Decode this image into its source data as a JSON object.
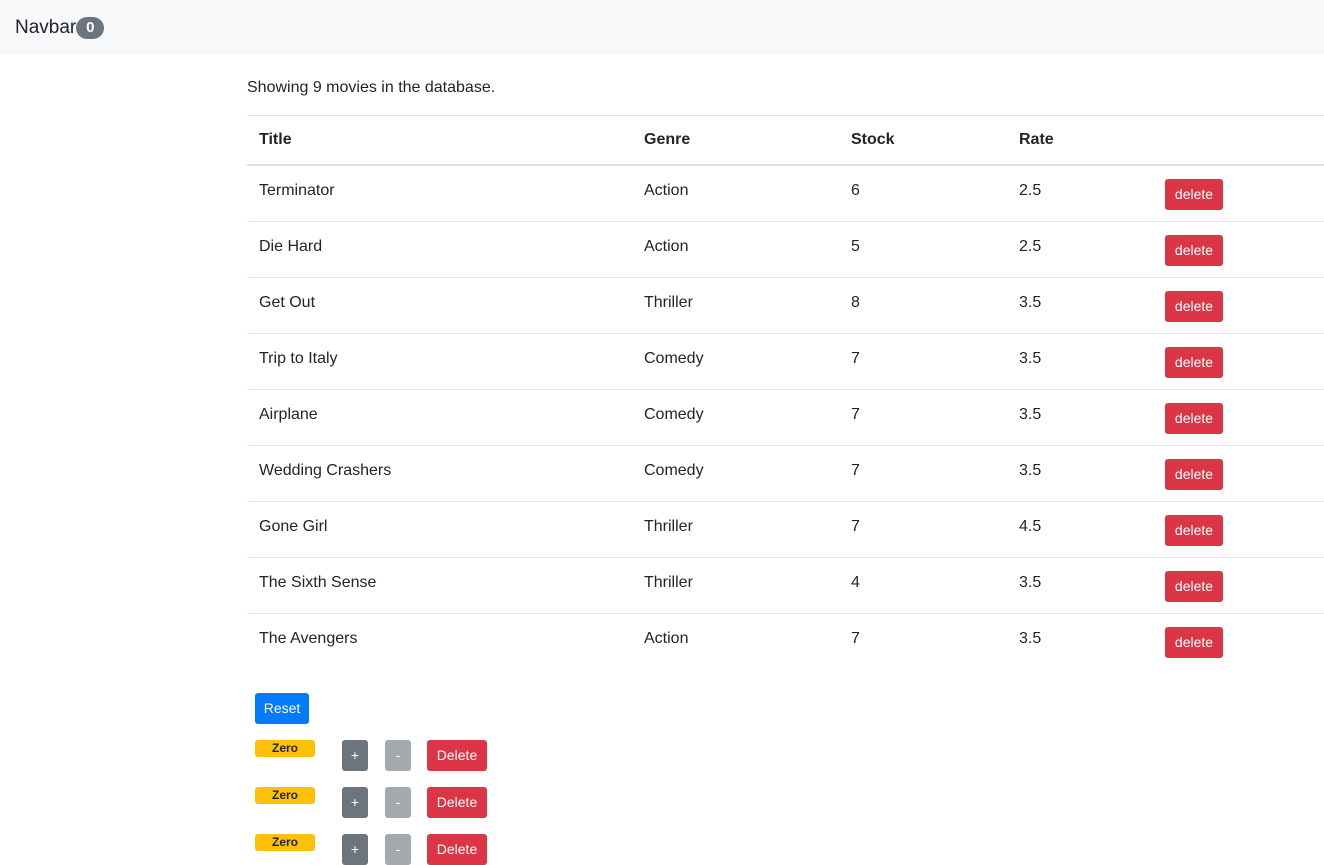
{
  "navbar": {
    "brand": "Navbar",
    "count": "0"
  },
  "summary": "Showing 9 movies in the database.",
  "table": {
    "headers": [
      "Title",
      "Genre",
      "Stock",
      "Rate",
      ""
    ],
    "rows": [
      {
        "title": "Terminator",
        "genre": "Action",
        "stock": "6",
        "rate": "2.5",
        "action": "delete"
      },
      {
        "title": "Die Hard",
        "genre": "Action",
        "stock": "5",
        "rate": "2.5",
        "action": "delete"
      },
      {
        "title": "Get Out",
        "genre": "Thriller",
        "stock": "8",
        "rate": "3.5",
        "action": "delete"
      },
      {
        "title": "Trip to Italy",
        "genre": "Comedy",
        "stock": "7",
        "rate": "3.5",
        "action": "delete"
      },
      {
        "title": "Airplane",
        "genre": "Comedy",
        "stock": "7",
        "rate": "3.5",
        "action": "delete"
      },
      {
        "title": "Wedding Crashers",
        "genre": "Comedy",
        "stock": "7",
        "rate": "3.5",
        "action": "delete"
      },
      {
        "title": "Gone Girl",
        "genre": "Thriller",
        "stock": "7",
        "rate": "4.5",
        "action": "delete"
      },
      {
        "title": "The Sixth Sense",
        "genre": "Thriller",
        "stock": "4",
        "rate": "3.5",
        "action": "delete"
      },
      {
        "title": "The Avengers",
        "genre": "Action",
        "stock": "7",
        "rate": "3.5",
        "action": "delete"
      }
    ]
  },
  "reset_label": "Reset",
  "counters": [
    {
      "badge": "Zero",
      "plus": "+",
      "minus": "-",
      "delete": "Delete"
    },
    {
      "badge": "Zero",
      "plus": "+",
      "minus": "-",
      "delete": "Delete"
    },
    {
      "badge": "Zero",
      "plus": "+",
      "minus": "-",
      "delete": "Delete"
    }
  ],
  "colors": {
    "navbar_bg": "#f8f9fa",
    "danger": "#dc3545",
    "primary": "#007bff",
    "secondary": "#6c757d",
    "warning": "#ffc107"
  }
}
